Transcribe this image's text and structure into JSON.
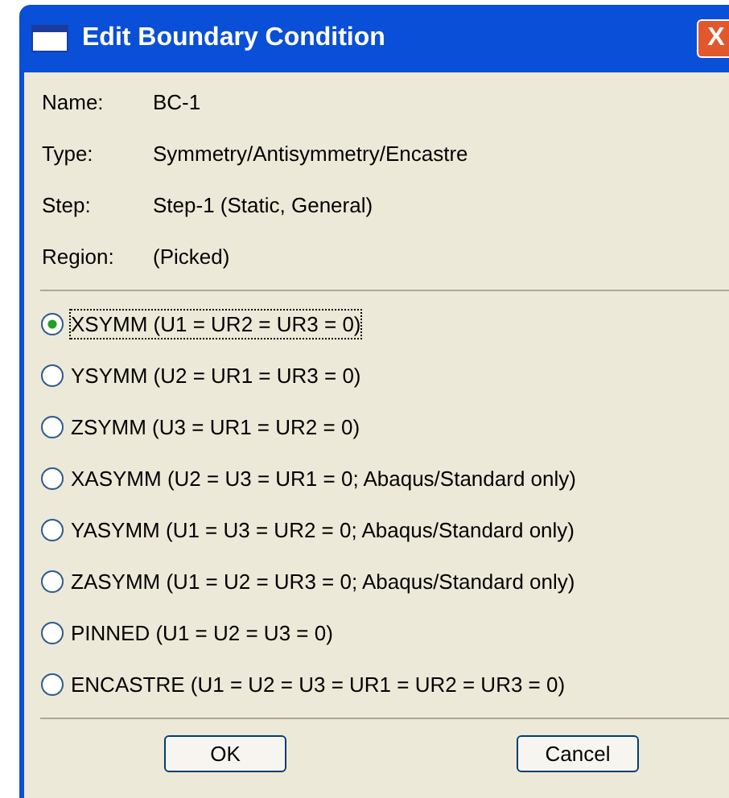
{
  "window": {
    "title": "Edit Boundary Condition",
    "close": "X"
  },
  "fields": [
    {
      "label": "Name:",
      "value": "BC-1"
    },
    {
      "label": "Type:",
      "value": "Symmetry/Antisymmetry/Encastre"
    },
    {
      "label": "Step:",
      "value": "Step-1 (Static, General)"
    },
    {
      "label": "Region:",
      "value": "(Picked)"
    }
  ],
  "options": [
    {
      "label": "XSYMM (U1 = UR2 = UR3 = 0)",
      "selected": true
    },
    {
      "label": "YSYMM (U2 = UR1 = UR3 = 0)",
      "selected": false
    },
    {
      "label": "ZSYMM (U3 = UR1 = UR2 = 0)",
      "selected": false
    },
    {
      "label": "XASYMM (U2 = U3 = UR1 = 0; Abaqus/Standard only)",
      "selected": false
    },
    {
      "label": "YASYMM (U1 = U3 = UR2 = 0; Abaqus/Standard only)",
      "selected": false
    },
    {
      "label": "ZASYMM (U1 = U2 = UR3 = 0; Abaqus/Standard only)",
      "selected": false
    },
    {
      "label": "PINNED (U1 = U2 = U3 = 0)",
      "selected": false
    },
    {
      "label": "ENCASTRE (U1 = U2 = U3 = UR1 = UR2 = UR3 = 0)",
      "selected": false
    }
  ],
  "buttons": [
    "OK",
    "Cancel"
  ]
}
